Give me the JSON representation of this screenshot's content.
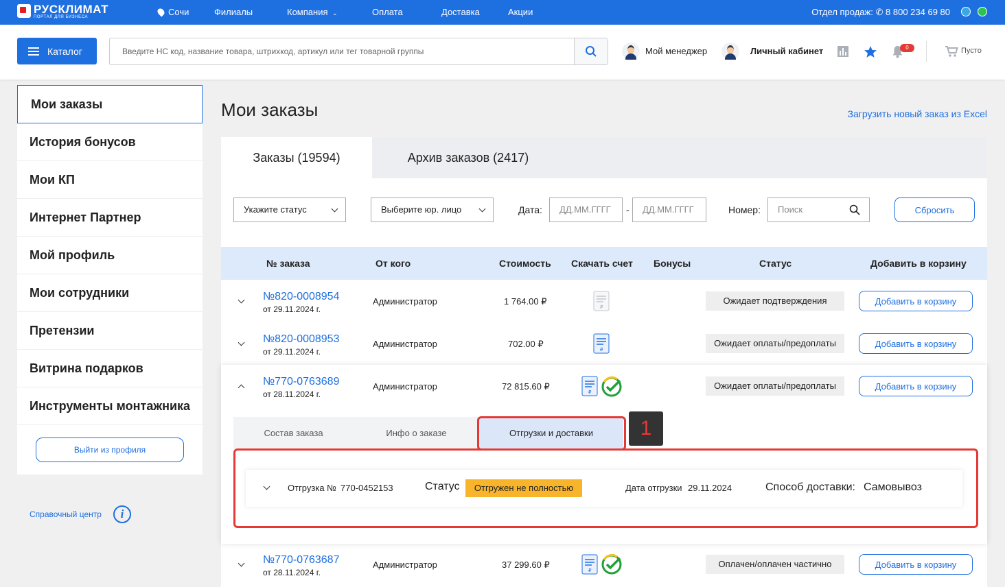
{
  "topbar": {
    "logo": "РУСКЛИМАТ",
    "logo_sub": "ПОРТАЛ ДЛЯ БИЗНЕСА",
    "city": "Сочи",
    "nav": [
      "Филиалы",
      "Компания",
      "Оплата",
      "Доставка",
      "Акции"
    ],
    "sales_label": "Отдел продаж:",
    "phone": "8 800 234 69 80"
  },
  "header": {
    "catalog_label": "Каталог",
    "search_placeholder": "Введите НС код, название товара, штрихкод, артикул или тег товарной группы",
    "manager": "Мой менеджер",
    "cabinet": "Личный кабинет",
    "notif_count": "0",
    "cart": "Пусто"
  },
  "sidebar": {
    "items": [
      "Мои заказы",
      "История бонусов",
      "Мои КП",
      "Интернет Партнер",
      "Мой профиль",
      "Мои сотрудники",
      "Претензии",
      "Витрина подарков",
      "Инструменты монтажника"
    ],
    "logout": "Выйти из профиля",
    "help": "Справочный центр"
  },
  "page": {
    "title": "Мои заказы",
    "excel_link": "Загрузить новый заказ из Excel",
    "tabs": [
      "Заказы (19594)",
      "Архив заказов (2417)"
    ],
    "filters": {
      "status": "Укажите статус",
      "entity": "Выберите юр. лицо",
      "date_label": "Дата:",
      "date_placeholder": "ДД.ММ.ГГГГ",
      "dash": "-",
      "number_label": "Номер:",
      "search_placeholder": "Поиск",
      "reset": "Сбросить"
    }
  },
  "table": {
    "headers": [
      "№ заказа",
      "От кого",
      "Стоимость",
      "Скачать счет",
      "Бонусы",
      "Статус",
      "Добавить в корзину"
    ],
    "rows": [
      {
        "number": "№820-0008954",
        "date": "от 29.11.2024 г.",
        "from": "Администратор",
        "cost": "1 764.00 ₽",
        "status": "Ожидает подтверждения",
        "add": "Добавить в корзину"
      },
      {
        "number": "№820-0008953",
        "date": "от 29.11.2024 г.",
        "from": "Администратор",
        "cost": "702.00 ₽",
        "status": "Ожидает оплаты/предоплаты",
        "add": "Добавить в корзину"
      },
      {
        "number": "№770-0763689",
        "date": "от 28.11.2024 г.",
        "from": "Администратор",
        "cost": "72 815.60 ₽",
        "status": "Ожидает оплаты/предоплаты",
        "add": "Добавить в корзину"
      },
      {
        "number": "№770-0763687",
        "date": "от 28.11.2024 г.",
        "from": "Администратор",
        "cost": "37 299.60 ₽",
        "status": "Оплачен/оплачен частично",
        "add": "Добавить в корзину"
      }
    ]
  },
  "expanded": {
    "subtabs": [
      "Состав заказа",
      "Инфо о заказе",
      "Отгрузки и доставки"
    ],
    "marker": "1",
    "shipment": {
      "label": "Отгрузка №",
      "number": "770-0452153",
      "status_label": "Статус",
      "status": "Отгружен не полностью",
      "date_label": "Дата отгрузки",
      "date": "29.11.2024",
      "delivery_label": "Способ доставки:",
      "delivery": "Самовывоз"
    }
  },
  "colors": {
    "accent": "#1e6fe0",
    "highlight": "#e53935",
    "badge": "#f8b42a"
  }
}
